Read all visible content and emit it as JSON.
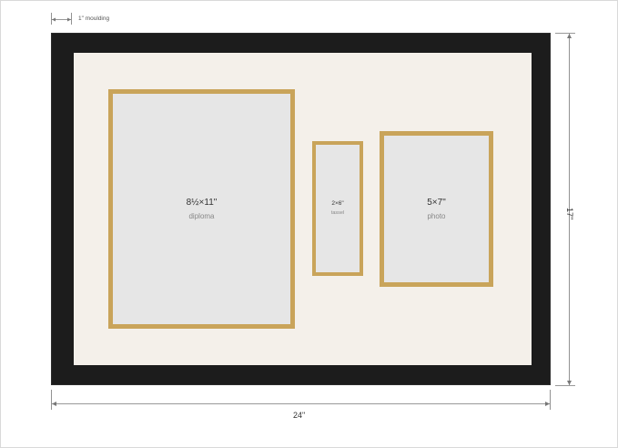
{
  "dimensions": {
    "moulding_label": "1\" moulding",
    "width_label": "24\"",
    "height_label": "17\""
  },
  "openings": {
    "diploma": {
      "size": "8½×11\"",
      "label": "diploma"
    },
    "tassel": {
      "size": "2×6\"",
      "label": "tassel"
    },
    "photo": {
      "size": "5×7\"",
      "label": "photo"
    }
  },
  "colors": {
    "frame": "#1c1c1c",
    "mat": "#f4f0ea",
    "opening_border": "#c9a45a",
    "opening_fill": "#e6e6e6"
  }
}
